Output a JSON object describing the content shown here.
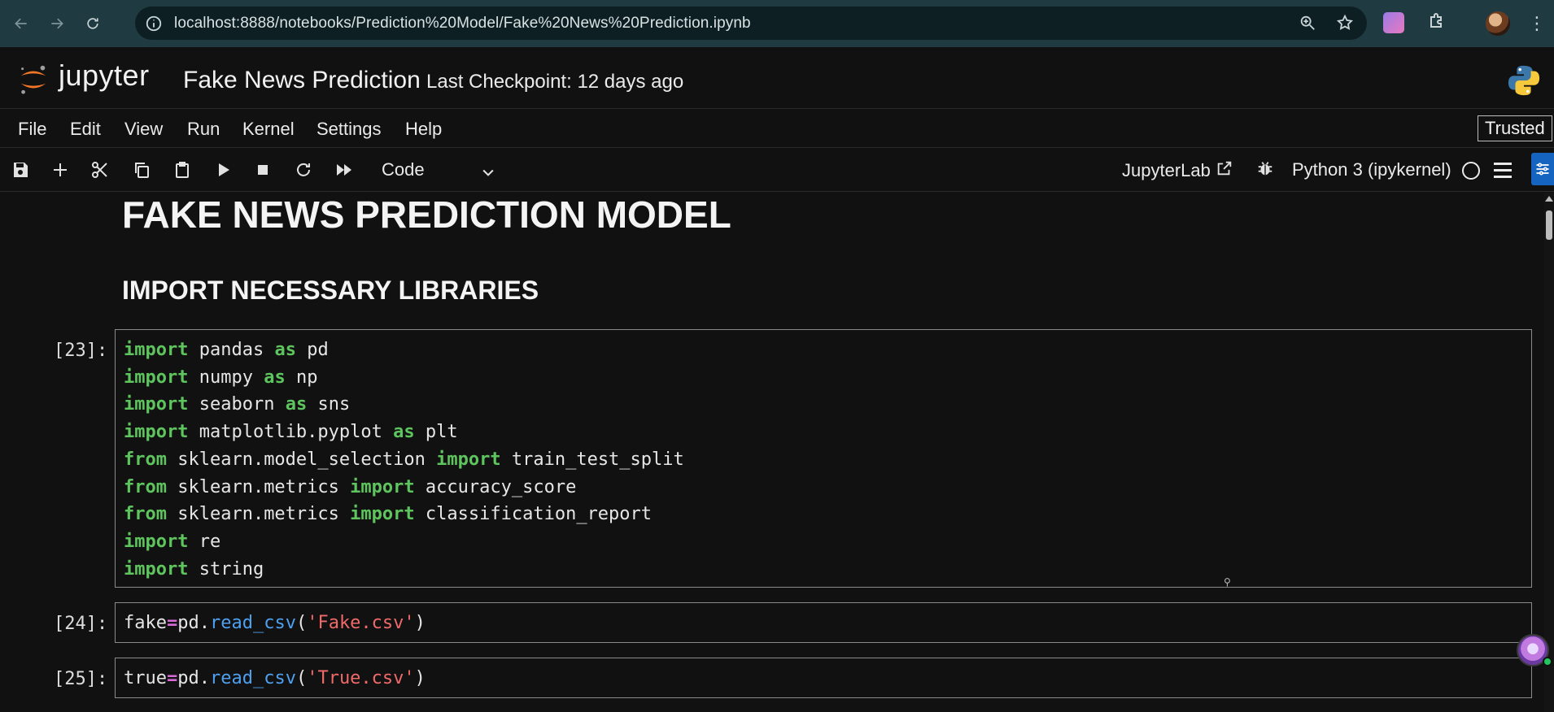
{
  "browser": {
    "url": "localhost:8888/notebooks/Prediction%20Model/Fake%20News%20Prediction.ipynb",
    "back_icon": "arrow-left-icon",
    "forward_icon": "arrow-right-icon",
    "reload_icon": "reload-icon"
  },
  "header": {
    "wordmark": "jupyter",
    "notebook_title": "Fake News Prediction",
    "checkpoint": "Last Checkpoint: 12 days ago"
  },
  "menu": {
    "items": [
      "File",
      "Edit",
      "View",
      "Run",
      "Kernel",
      "Settings",
      "Help"
    ],
    "trusted": "Trusted"
  },
  "toolbar": {
    "cell_type": "Code",
    "jupyterlab_label": "JupyterLab",
    "kernel_name": "Python 3 (ipykernel)"
  },
  "notebook": {
    "h1": "FAKE NEWS PREDICTION MODEL",
    "h2": "IMPORT NECESSARY LIBRARIES",
    "cells": [
      {
        "prompt": "[23]:",
        "lines": [
          [
            {
              "t": "import",
              "c": "kw"
            },
            {
              "t": " pandas ",
              "c": ""
            },
            {
              "t": "as",
              "c": "kw"
            },
            {
              "t": " pd",
              "c": ""
            }
          ],
          [
            {
              "t": "import",
              "c": "kw"
            },
            {
              "t": " numpy ",
              "c": ""
            },
            {
              "t": "as",
              "c": "kw"
            },
            {
              "t": " np",
              "c": ""
            }
          ],
          [
            {
              "t": "import",
              "c": "kw"
            },
            {
              "t": " seaborn ",
              "c": ""
            },
            {
              "t": "as",
              "c": "kw"
            },
            {
              "t": " sns",
              "c": ""
            }
          ],
          [
            {
              "t": "import",
              "c": "kw"
            },
            {
              "t": " matplotlib.pyplot ",
              "c": ""
            },
            {
              "t": "as",
              "c": "kw"
            },
            {
              "t": " plt",
              "c": ""
            }
          ],
          [
            {
              "t": "from",
              "c": "kw"
            },
            {
              "t": " sklearn.model_selection ",
              "c": ""
            },
            {
              "t": "import",
              "c": "kw"
            },
            {
              "t": " train_test_split",
              "c": ""
            }
          ],
          [
            {
              "t": "from",
              "c": "kw"
            },
            {
              "t": " sklearn.metrics ",
              "c": ""
            },
            {
              "t": "import",
              "c": "kw"
            },
            {
              "t": " accuracy_score",
              "c": ""
            }
          ],
          [
            {
              "t": "from",
              "c": "kw"
            },
            {
              "t": " sklearn.metrics ",
              "c": ""
            },
            {
              "t": "import",
              "c": "kw"
            },
            {
              "t": " classification_report",
              "c": ""
            }
          ],
          [
            {
              "t": "import",
              "c": "kw"
            },
            {
              "t": " re",
              "c": ""
            }
          ],
          [
            {
              "t": "import",
              "c": "kw"
            },
            {
              "t": " string",
              "c": ""
            }
          ]
        ]
      },
      {
        "prompt": "[24]:",
        "lines": [
          [
            {
              "t": "fake",
              "c": ""
            },
            {
              "t": "=",
              "c": "op"
            },
            {
              "t": "pd.",
              "c": ""
            },
            {
              "t": "read_csv",
              "c": "fn"
            },
            {
              "t": "(",
              "c": ""
            },
            {
              "t": "'Fake.csv'",
              "c": "str"
            },
            {
              "t": ")",
              "c": ""
            }
          ]
        ]
      },
      {
        "prompt": "[25]:",
        "lines": [
          [
            {
              "t": "true",
              "c": ""
            },
            {
              "t": "=",
              "c": "op"
            },
            {
              "t": "pd.",
              "c": ""
            },
            {
              "t": "read_csv",
              "c": "fn"
            },
            {
              "t": "(",
              "c": ""
            },
            {
              "t": "'True.csv'",
              "c": "str"
            },
            {
              "t": ")",
              "c": ""
            }
          ]
        ]
      }
    ]
  }
}
